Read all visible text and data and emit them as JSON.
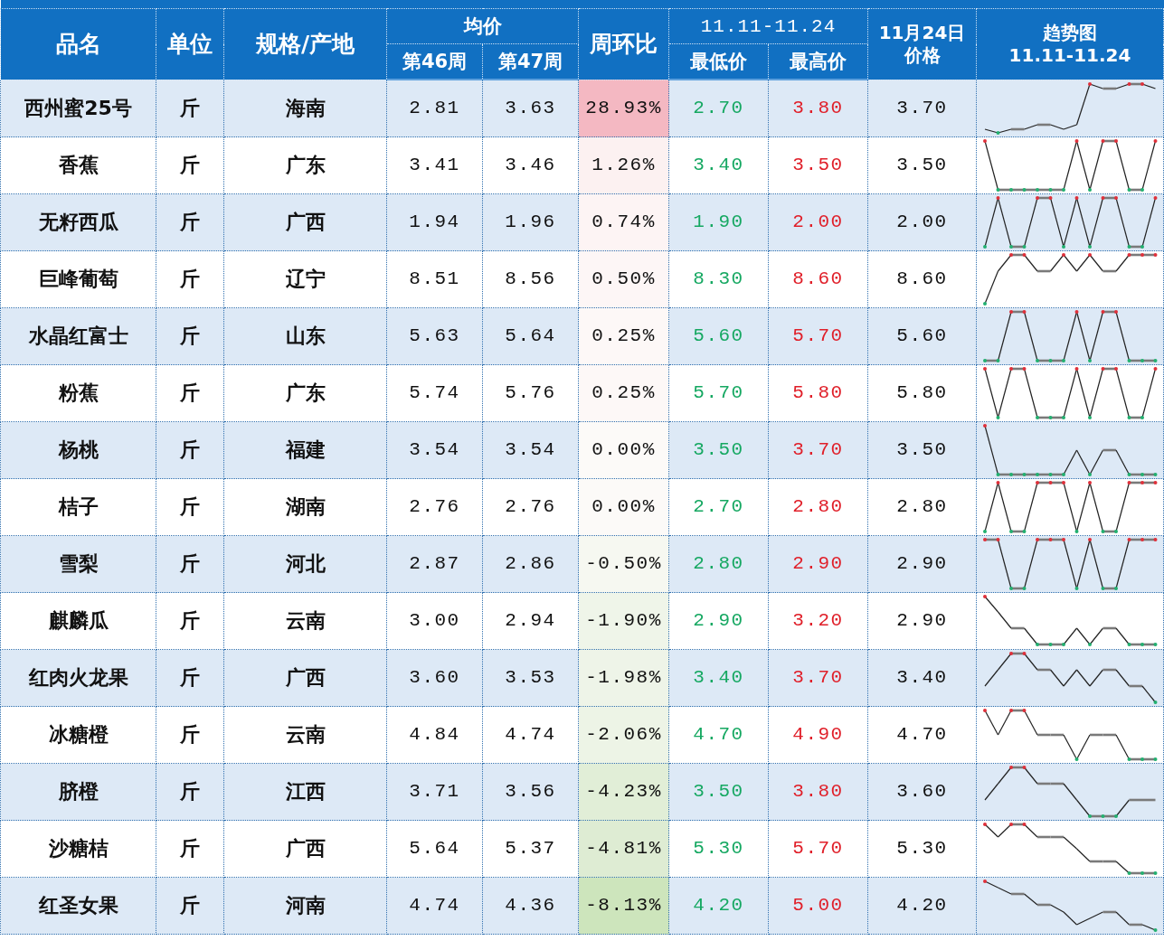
{
  "header": {
    "name": "品名",
    "unit": "单位",
    "origin": "规格/产地",
    "average": "均价",
    "week46": "第46周",
    "week47": "第47周",
    "change": "周环比",
    "range": "11.11-11.24",
    "low": "最低价",
    "high": "最高价",
    "price_date": "11月24日",
    "price_label": "价格",
    "trend_label": "趋势图",
    "trend_range": "11.11-11.24"
  },
  "rows": [
    {
      "name": "西州蜜25号",
      "unit": "斤",
      "origin": "海南",
      "week46": "2.81",
      "week47": "3.63",
      "change": "28.93%",
      "color": "#f4b8c2",
      "low": "2.70",
      "high": "3.80",
      "price": "3.70"
    },
    {
      "name": "香蕉",
      "unit": "斤",
      "origin": "广东",
      "week46": "3.41",
      "week47": "3.46",
      "change": "1.26%",
      "color": "#fcf1f1",
      "low": "3.40",
      "high": "3.50",
      "price": "3.50"
    },
    {
      "name": "无籽西瓜",
      "unit": "斤",
      "origin": "广西",
      "week46": "1.94",
      "week47": "1.96",
      "change": "0.74%",
      "color": "#fdf4f4",
      "low": "1.90",
      "high": "2.00",
      "price": "2.00"
    },
    {
      "name": "巨峰葡萄",
      "unit": "斤",
      "origin": "辽宁",
      "week46": "8.51",
      "week47": "8.56",
      "change": "0.50%",
      "color": "#fdf6f6",
      "low": "8.30",
      "high": "8.60",
      "price": "8.60"
    },
    {
      "name": "水晶红富士",
      "unit": "斤",
      "origin": "山东",
      "week46": "5.63",
      "week47": "5.64",
      "change": "0.25%",
      "color": "#fdf8f7",
      "low": "5.60",
      "high": "5.70",
      "price": "5.60"
    },
    {
      "name": "粉蕉",
      "unit": "斤",
      "origin": "广东",
      "week46": "5.74",
      "week47": "5.76",
      "change": "0.25%",
      "color": "#fdf8f7",
      "low": "5.70",
      "high": "5.80",
      "price": "5.80"
    },
    {
      "name": "杨桃",
      "unit": "斤",
      "origin": "福建",
      "week46": "3.54",
      "week47": "3.54",
      "change": "0.00%",
      "color": "#fcfaf8",
      "low": "3.50",
      "high": "3.70",
      "price": "3.50"
    },
    {
      "name": "桔子",
      "unit": "斤",
      "origin": "湖南",
      "week46": "2.76",
      "week47": "2.76",
      "change": "0.00%",
      "color": "#fcfaf8",
      "low": "2.70",
      "high": "2.80",
      "price": "2.80"
    },
    {
      "name": "雪梨",
      "unit": "斤",
      "origin": "河北",
      "week46": "2.87",
      "week47": "2.86",
      "change": "-0.50%",
      "color": "#f6f8f1",
      "low": "2.80",
      "high": "2.90",
      "price": "2.90"
    },
    {
      "name": "麒麟瓜",
      "unit": "斤",
      "origin": "云南",
      "week46": "3.00",
      "week47": "2.94",
      "change": "-1.90%",
      "color": "#eff5e9",
      "low": "2.90",
      "high": "3.20",
      "price": "2.90"
    },
    {
      "name": "红肉火龙果",
      "unit": "斤",
      "origin": "广西",
      "week46": "3.60",
      "week47": "3.53",
      "change": "-1.98%",
      "color": "#eef4e8",
      "low": "3.40",
      "high": "3.70",
      "price": "3.40"
    },
    {
      "name": "冰糖橙",
      "unit": "斤",
      "origin": "云南",
      "week46": "4.84",
      "week47": "4.74",
      "change": "-2.06%",
      "color": "#edf4e6",
      "low": "4.70",
      "high": "4.90",
      "price": "4.70"
    },
    {
      "name": "脐橙",
      "unit": "斤",
      "origin": "江西",
      "week46": "3.71",
      "week47": "3.56",
      "change": "-4.23%",
      "color": "#e1eed7",
      "low": "3.50",
      "high": "3.80",
      "price": "3.60"
    },
    {
      "name": "沙糖桔",
      "unit": "斤",
      "origin": "广西",
      "week46": "5.64",
      "week47": "5.37",
      "change": "-4.81%",
      "color": "#deecd3",
      "low": "5.30",
      "high": "5.70",
      "price": "5.30"
    },
    {
      "name": "红圣女果",
      "unit": "斤",
      "origin": "河南",
      "week46": "4.74",
      "week47": "4.36",
      "change": "-8.13%",
      "color": "#cde5bc",
      "low": "4.20",
      "high": "5.00",
      "price": "4.20"
    }
  ]
}
